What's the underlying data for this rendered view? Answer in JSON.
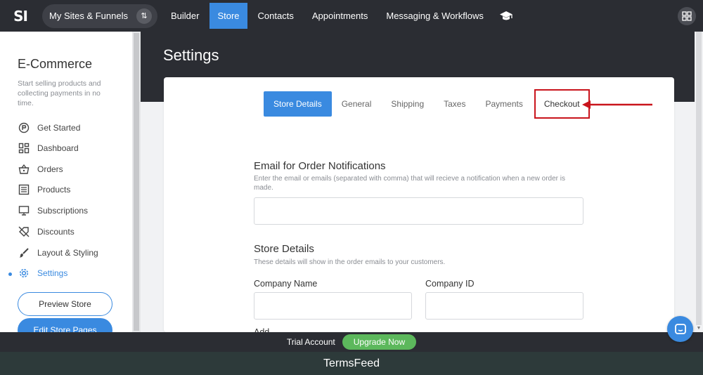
{
  "topnav": {
    "logo": "SI",
    "sites_label": "My Sites & Funnels",
    "items": [
      {
        "label": "Builder",
        "active": false
      },
      {
        "label": "Store",
        "active": true
      },
      {
        "label": "Contacts",
        "active": false
      },
      {
        "label": "Appointments",
        "active": false
      },
      {
        "label": "Messaging & Workflows",
        "active": false
      }
    ],
    "accent": "#3a8ae0",
    "bg": "#2b2d33"
  },
  "page": {
    "title": "Settings"
  },
  "sidebar": {
    "title": "E-Commerce",
    "description": "Start selling products and collecting payments in no time.",
    "items": [
      {
        "label": "Get Started",
        "icon": "rocket-icon"
      },
      {
        "label": "Dashboard",
        "icon": "dashboard-icon"
      },
      {
        "label": "Orders",
        "icon": "basket-icon"
      },
      {
        "label": "Products",
        "icon": "list-icon"
      },
      {
        "label": "Subscriptions",
        "icon": "monitor-icon"
      },
      {
        "label": "Discounts",
        "icon": "tag-off-icon"
      },
      {
        "label": "Layout & Styling",
        "icon": "brush-icon"
      },
      {
        "label": "Settings",
        "icon": "gear-icon",
        "active": true
      }
    ],
    "preview_label": "Preview Store",
    "edit_label": "Edit Store Pages"
  },
  "tabs": [
    {
      "label": "Store Details",
      "active": true
    },
    {
      "label": "General"
    },
    {
      "label": "Shipping"
    },
    {
      "label": "Taxes"
    },
    {
      "label": "Payments"
    },
    {
      "label": "Checkout",
      "highlighted": true
    }
  ],
  "email_section": {
    "title": "Email for Order Notifications",
    "description": "Enter the email or emails (separated with comma) that will recieve a notification when a new order is made.",
    "value": ""
  },
  "store_section": {
    "title": "Store Details",
    "description": "These details will show in the order emails to your customers.",
    "company_name_label": "Company Name",
    "company_id_label": "Company ID",
    "company_name_value": "",
    "company_id_value": "",
    "next_label_partial": "Add"
  },
  "trial": {
    "text": "Trial Account",
    "upgrade_label": "Upgrade Now",
    "upgrade_color": "#5cb85c"
  },
  "footer": {
    "text": "TermsFeed"
  },
  "highlight_color": "#c9141c"
}
